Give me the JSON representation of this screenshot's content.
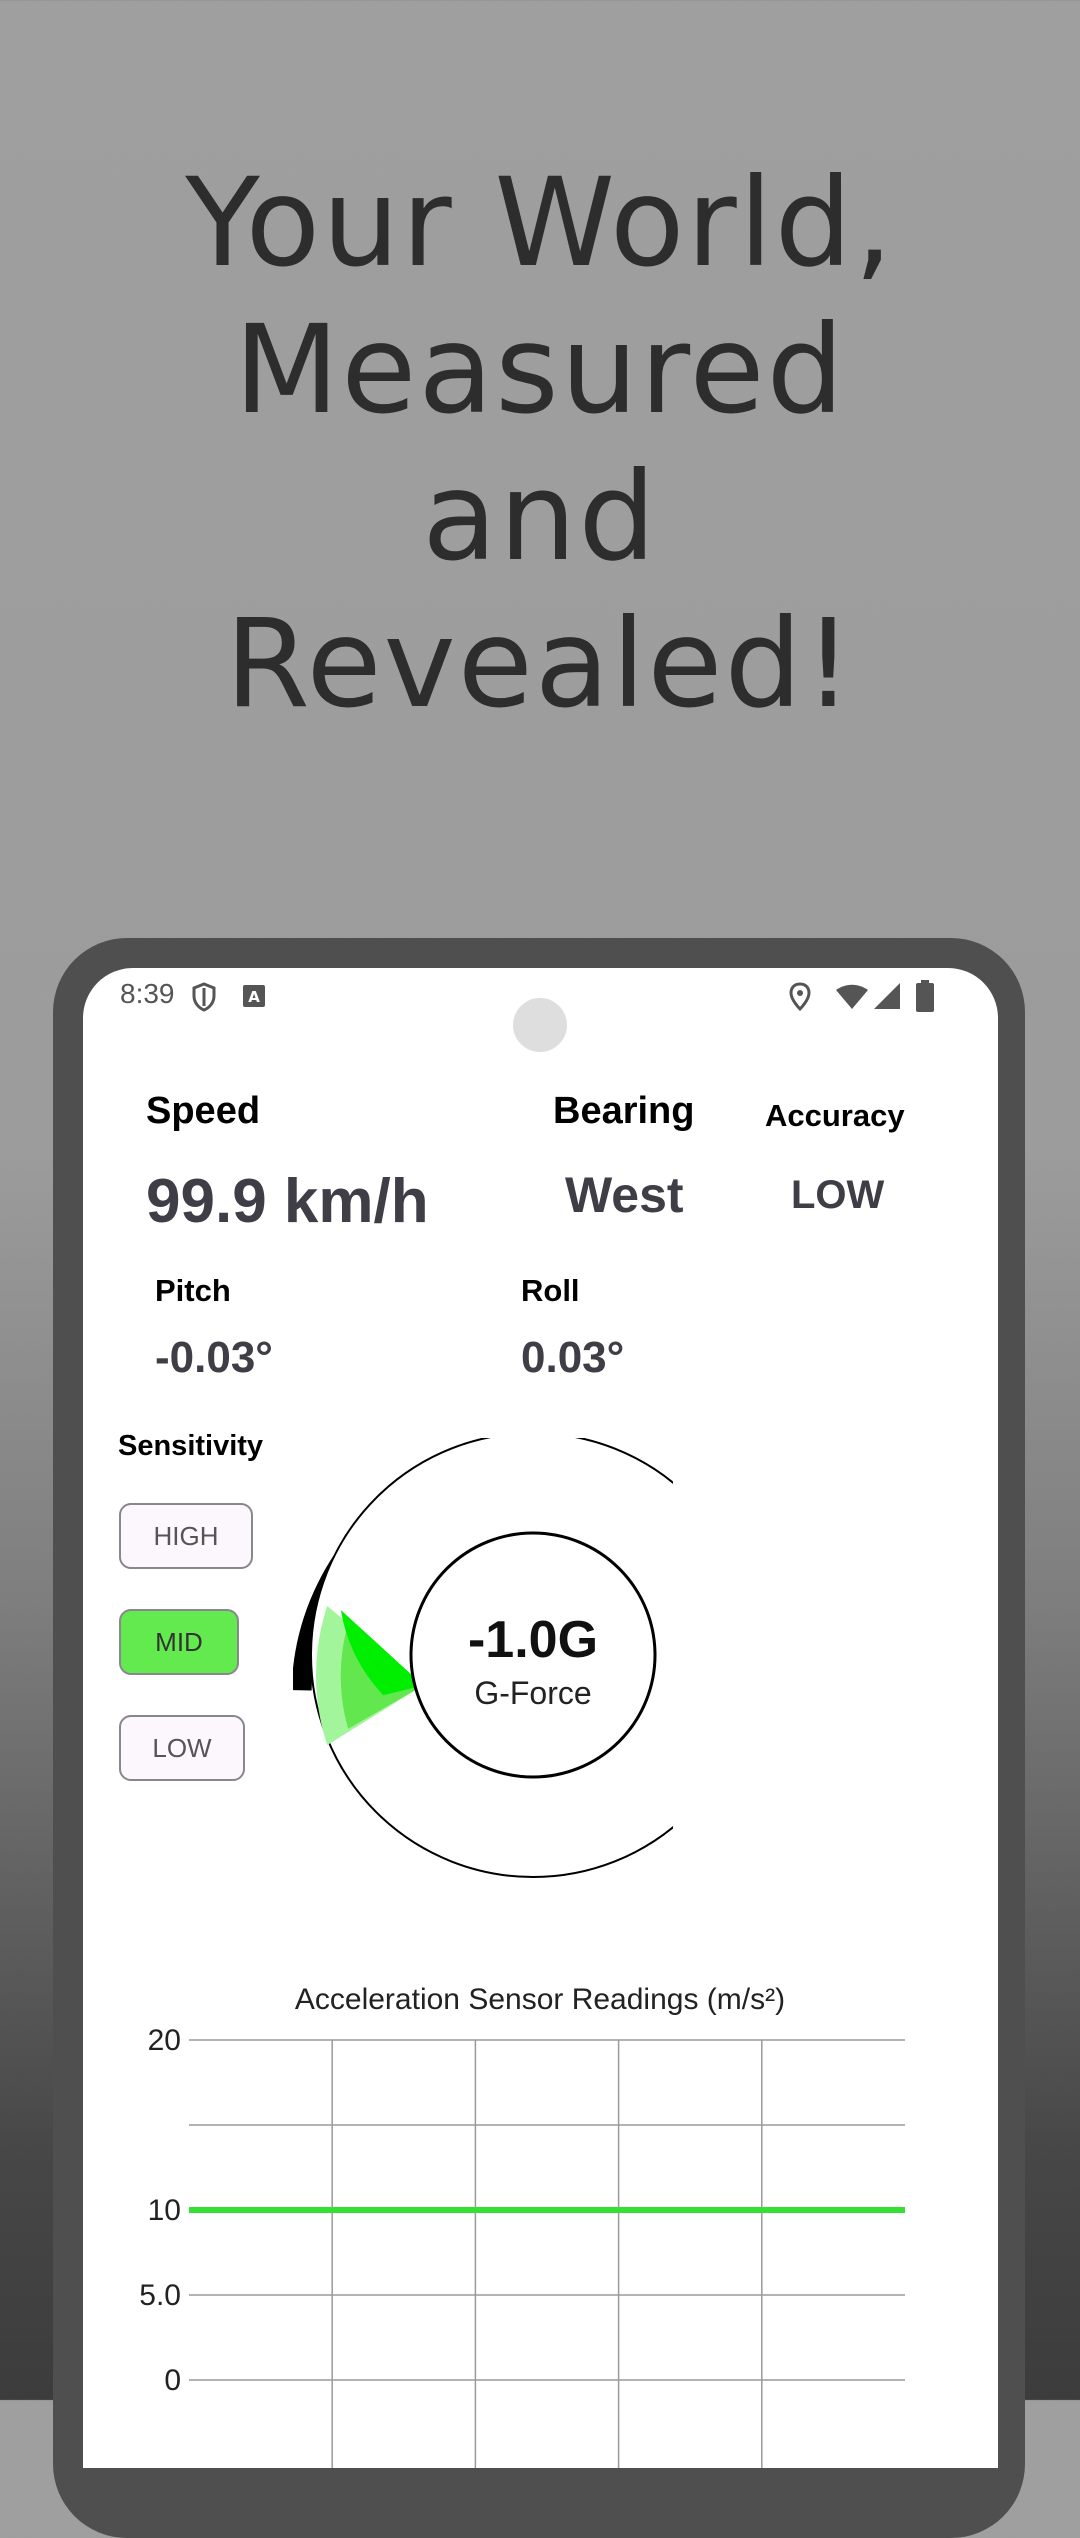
{
  "promo": {
    "headline_lines": [
      "Your World,",
      "Measured",
      "and",
      "Revealed!"
    ]
  },
  "status_bar": {
    "time": "8:39",
    "left_icons": [
      "shield-icon",
      "text-a-icon"
    ],
    "right_icons": [
      "location-pin-icon",
      "wifi-icon",
      "cell-signal-icon",
      "battery-icon"
    ]
  },
  "metrics": {
    "speed_label": "Speed",
    "speed_value": "99.9 km/h",
    "bearing_label": "Bearing",
    "bearing_value": "West",
    "accuracy_label": "Accuracy",
    "accuracy_value": "LOW",
    "pitch_label": "Pitch",
    "pitch_value": "-0.03°",
    "roll_label": "Roll",
    "roll_value": "0.03°"
  },
  "sensitivity": {
    "label": "Sensitivity",
    "options": [
      "HIGH",
      "MID",
      "LOW"
    ],
    "selected": "MID"
  },
  "gauge": {
    "value": "-1.0G",
    "label": "G-Force",
    "colors": {
      "dark_arc": "#000000",
      "gray_arc": "#9a9a9a",
      "green_arc": "#9fc29a",
      "bright_green": "#00ee00"
    }
  },
  "chart_data": {
    "type": "line",
    "title": "Acceleration Sensor Readings (m/s²)",
    "y_ticks": [
      "20",
      "10",
      "5.0",
      "0"
    ],
    "ylim": [
      0,
      20
    ],
    "grid": true,
    "series": [
      {
        "color": "#33e033",
        "values": [
          10,
          10,
          10,
          10,
          10,
          10
        ]
      }
    ]
  }
}
